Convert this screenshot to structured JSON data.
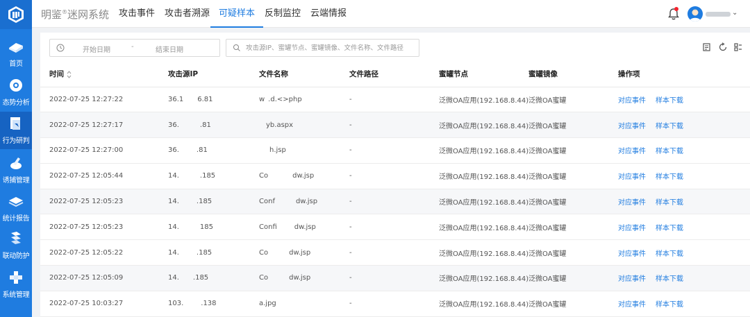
{
  "brand": {
    "name": "明鉴",
    "sup": "®",
    "suffix": "迷网系统"
  },
  "nav": [
    {
      "label": "攻击事件"
    },
    {
      "label": "攻击者溯源"
    },
    {
      "label": "可疑样本"
    },
    {
      "label": "反制监控"
    },
    {
      "label": "云端情报"
    }
  ],
  "active_nav": "可疑样本",
  "sidebar": [
    {
      "label": "首页",
      "icon": "home-icon"
    },
    {
      "label": "态势分析",
      "icon": "situation-icon"
    },
    {
      "label": "行为研判",
      "icon": "behavior-icon"
    },
    {
      "label": "诱捕管理",
      "icon": "trap-icon"
    },
    {
      "label": "统计报告",
      "icon": "report-icon"
    },
    {
      "label": "联动防护",
      "icon": "linkage-icon"
    },
    {
      "label": "系统管理",
      "icon": "settings-icon"
    }
  ],
  "active_sidebar": "行为研判",
  "filter": {
    "start_date_placeholder": "开始日期",
    "date_separator": "-",
    "end_date_placeholder": "结束日期",
    "search_placeholder": "攻击源IP、蜜罐节点、蜜罐镜像、文件名称、文件路径"
  },
  "colors": {
    "primary": "#1f7ce0",
    "sidebar": "#1f7ce0",
    "notification_dot": "#f5222d"
  },
  "table": {
    "columns": [
      "时间",
      "攻击源IP",
      "文件名称",
      "文件路径",
      "蜜罐节点",
      "蜜罐镜像",
      "操作项"
    ],
    "action_labels": {
      "event": "对应事件",
      "download": "样本下载"
    },
    "rows": [
      {
        "time": "2022-07-25 12:27:22",
        "ip": "36.1    6.81",
        "file": "w .d.<>php",
        "path": "-",
        "node": "泛微OA应用(192.168.8.44)",
        "image": "泛微OA蜜罐"
      },
      {
        "time": "2022-07-25 12:27:17",
        "ip": "36.      .81",
        "file": "  yb.aspx",
        "path": "-",
        "node": "泛微OA应用(192.168.8.44)",
        "image": "泛微OA蜜罐"
      },
      {
        "time": "2022-07-25 12:27:00",
        "ip": "36.     .81",
        "file": "   h.jsp",
        "path": "-",
        "node": "泛微OA应用(192.168.8.44)",
        "image": "泛微OA蜜罐"
      },
      {
        "time": "2022-07-25 12:05:44",
        "ip": "14.      .185",
        "file": "Co       dw.jsp",
        "path": "-",
        "node": "泛微OA应用(192.168.8.44)",
        "image": "泛微OA蜜罐"
      },
      {
        "time": "2022-07-25 12:05:23",
        "ip": "14.     .185",
        "file": "Conf      dw.jsp",
        "path": "-",
        "node": "泛微OA应用(192.168.8.44)",
        "image": "泛微OA蜜罐"
      },
      {
        "time": "2022-07-25 12:05:23",
        "ip": "14.      185",
        "file": "Confi     dw.jsp",
        "path": "-",
        "node": "泛微OA应用(192.168.8.44)",
        "image": "泛微OA蜜罐"
      },
      {
        "time": "2022-07-25 12:05:22",
        "ip": "14.     .185",
        "file": "Co      dw.jsp",
        "path": "-",
        "node": "泛微OA应用(192.168.8.44)",
        "image": "泛微OA蜜罐"
      },
      {
        "time": "2022-07-25 12:05:09",
        "ip": "14.    .185",
        "file": "Co      dw.jsp",
        "path": "-",
        "node": "泛微OA应用(192.168.8.44)",
        "image": "泛微OA蜜罐"
      },
      {
        "time": "2022-07-25 10:03:27",
        "ip": "103.     .138",
        "file": "a.jpg",
        "path": "-",
        "node": "泛微OA应用(192.168.8.44)",
        "image": "泛微OA蜜罐"
      }
    ]
  }
}
